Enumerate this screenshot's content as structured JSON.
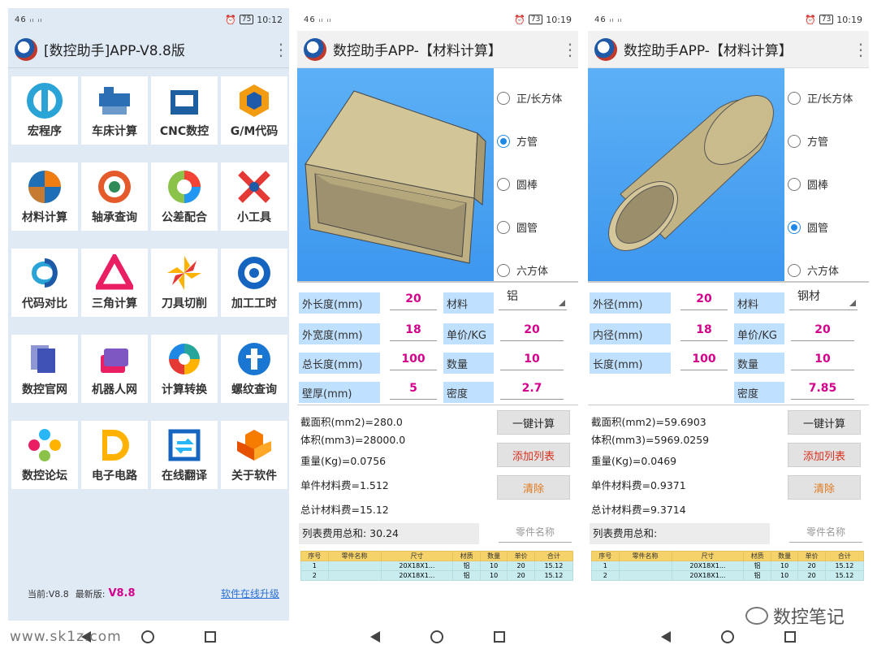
{
  "status": {
    "time1": "10:12",
    "time2": "10:19",
    "time3": "10:19",
    "battery1": "75",
    "battery2": "73",
    "battery3": "73",
    "signal": "46 ᵢₗ ᵢₗ"
  },
  "home": {
    "title": "[数控助手]APP-V8.8版",
    "tiles": [
      {
        "label": "宏程序",
        "icon": "puzzle-icon",
        "color": "#2aa3d6"
      },
      {
        "label": "车床计算",
        "icon": "lathe-icon",
        "color": "#2c6fb5"
      },
      {
        "label": "CNC数控",
        "icon": "cnc-machine-icon",
        "color": "#1d5fa0"
      },
      {
        "label": "G/M代码",
        "icon": "hexagon-icon",
        "color": "#f39c12"
      },
      {
        "label": "材料计算",
        "icon": "pie-icon",
        "color": "#f07d12"
      },
      {
        "label": "轴承查询",
        "icon": "bearing-icon",
        "color": "#e55a2b"
      },
      {
        "label": "公差配合",
        "icon": "tolerance-ring-icon",
        "color": "#8bc34a"
      },
      {
        "label": "小工具",
        "icon": "wrench-icon",
        "color": "#e53935"
      },
      {
        "label": "代码对比",
        "icon": "knot-icon",
        "color": "#2aa3d6"
      },
      {
        "label": "三角计算",
        "icon": "triangle-icon",
        "color": "#e91e63"
      },
      {
        "label": "刀具切削",
        "icon": "pinwheel-icon",
        "color": "#ffb300"
      },
      {
        "label": "加工工时",
        "icon": "clock-ring-icon",
        "color": "#1565c0"
      },
      {
        "label": "数控官网",
        "icon": "layers-icon",
        "color": "#3f51b5"
      },
      {
        "label": "机器人网",
        "icon": "cards-icon",
        "color": "#7e57c2"
      },
      {
        "label": "计算转换",
        "icon": "swirl-icon",
        "color": "#26a69a"
      },
      {
        "label": "螺纹查询",
        "icon": "screw-icon",
        "color": "#1976d2"
      },
      {
        "label": "数控论坛",
        "icon": "flower-icon",
        "color": "#29b6f6"
      },
      {
        "label": "电子电路",
        "icon": "d-letter-icon",
        "color": "#ffb300"
      },
      {
        "label": "在线翻译",
        "icon": "exchange-icon",
        "color": "#1565c0"
      },
      {
        "label": "关于软件",
        "icon": "cubes-icon",
        "color": "#f57c00"
      }
    ],
    "current_version_label": "当前:V8.8",
    "latest_version_label": "最新版:",
    "latest_version": "V8.8",
    "upgrade_link": "软件在线升级"
  },
  "calc1": {
    "title": "数控助手APP-【材料计算】",
    "shapes": [
      "正/长方体",
      "方管",
      "圆棒",
      "圆管",
      "六方体"
    ],
    "selected_shape": "方管",
    "fields": {
      "outer_length_label": "外长度(mm)",
      "outer_length": "20",
      "outer_width_label": "外宽度(mm)",
      "outer_width": "18",
      "total_length_label": "总长度(mm)",
      "total_length": "100",
      "wall_label": "壁厚(mm)",
      "wall": "5",
      "material_label": "材料",
      "material": "铝",
      "price_label": "单价/KG",
      "price": "20",
      "qty_label": "数量",
      "qty": "10",
      "density_label": "密度",
      "density": "2.7"
    },
    "results": {
      "area": "截面积(mm2)=280.0",
      "volume": "体积(mm3)=28000.0",
      "weight": "重量(Kg)=0.0756",
      "unit_cost": "单件材料费=1.512",
      "total_cost": "总计材料费=15.12",
      "list_total": "列表费用总和: 30.24"
    }
  },
  "calc2": {
    "title": "数控助手APP-【材料计算】",
    "shapes": [
      "正/长方体",
      "方管",
      "圆棒",
      "圆管",
      "六方体"
    ],
    "selected_shape": "圆管",
    "fields": {
      "outer_d_label": "外径(mm)",
      "outer_d": "20",
      "inner_d_label": "内径(mm)",
      "inner_d": "18",
      "length_label": "长度(mm)",
      "length": "100",
      "material_label": "材料",
      "material": "钢材",
      "price_label": "单价/KG",
      "price": "20",
      "qty_label": "数量",
      "qty": "10",
      "density_label": "密度",
      "density": "7.85"
    },
    "results": {
      "area": "截面积(mm2)=59.6903",
      "volume": "体积(mm3)=5969.0259",
      "weight": "重量(Kg)=0.0469",
      "unit_cost": "单件材料费=0.9371",
      "total_cost": "总计材料费=9.3714",
      "list_total": "列表费用总和:"
    }
  },
  "buttons": {
    "calc": "一键计算",
    "add": "添加列表",
    "clear": "清除",
    "part_name_placeholder": "零件名称"
  },
  "table": {
    "headers": [
      "序号",
      "零件名称",
      "尺寸",
      "材质",
      "数量",
      "单价",
      "合计"
    ],
    "rows1": [
      [
        "1",
        "",
        "20X18X1...",
        "铝",
        "10",
        "20",
        "15.12"
      ],
      [
        "2",
        "",
        "20X18X1...",
        "铝",
        "10",
        "20",
        "15.12"
      ]
    ],
    "rows2": [
      [
        "1",
        "",
        "20X18X1...",
        "铝",
        "10",
        "20",
        "15.12"
      ],
      [
        "2",
        "",
        "20X18X1...",
        "铝",
        "10",
        "20",
        "15.12"
      ]
    ]
  },
  "watermarks": {
    "site": "www.sk1z.com",
    "brand": "数控笔记"
  }
}
